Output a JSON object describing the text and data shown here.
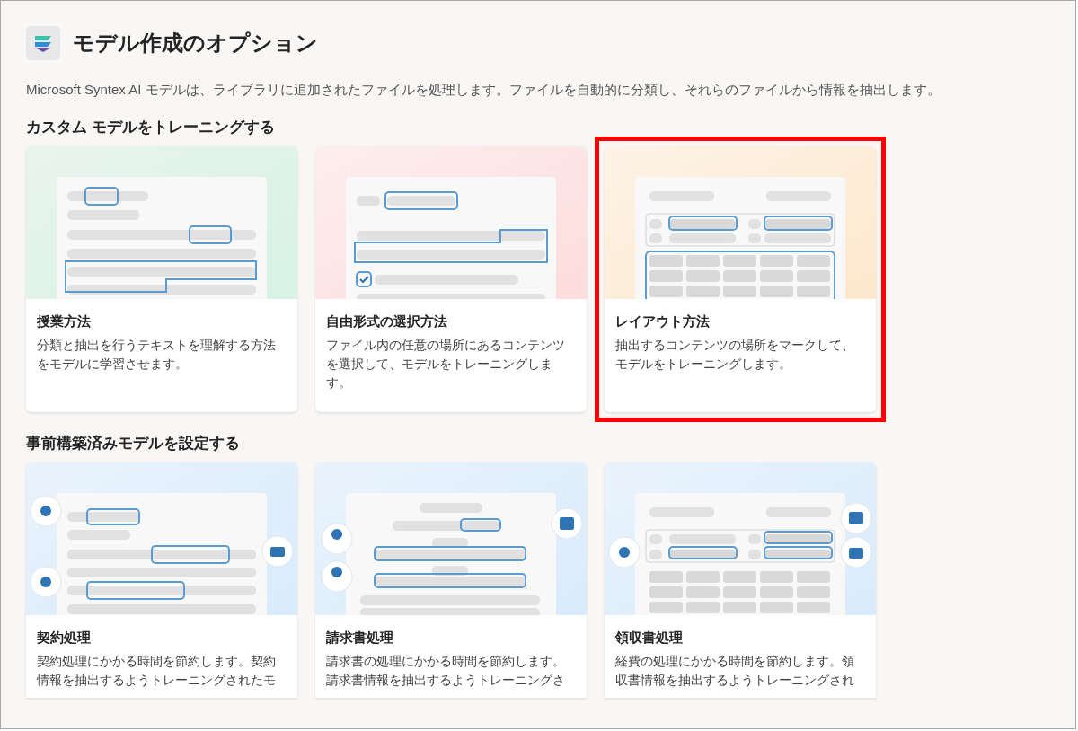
{
  "header": {
    "title": "モデル作成のオプション",
    "description": "Microsoft Syntex AI モデルは、ライブラリに追加されたファイルを処理します。ファイルを自動的に分類し、それらのファイルから情報を抽出します。"
  },
  "sections": [
    {
      "heading": "カスタム モデルをトレーニングする",
      "cards": [
        {
          "kind": "teaching",
          "title": "授業方法",
          "description": "分類と抽出を行うテキストを理解する方法をモデルに学習させます。",
          "highlighted": false
        },
        {
          "kind": "freeform",
          "title": "自由形式の選択方法",
          "description": "ファイル内の任意の場所にあるコンテンツを選択して、モデルをトレーニングします。",
          "highlighted": false
        },
        {
          "kind": "layout",
          "title": "レイアウト方法",
          "description": "抽出するコンテンツの場所をマークして、モデルをトレーニングします。",
          "highlighted": true
        }
      ]
    },
    {
      "heading": "事前構築済みモデルを設定する",
      "cards": [
        {
          "kind": "contract",
          "title": "契約処理",
          "description": "契約処理にかかる時間を節約します。契約情報を抽出するようトレーニングされたモ",
          "highlighted": false
        },
        {
          "kind": "invoice",
          "title": "請求書処理",
          "description": "請求書の処理にかかる時間を節約します。請求書情報を抽出するようトレーニングさ",
          "highlighted": false
        },
        {
          "kind": "receipt",
          "title": "領収書処理",
          "description": "経費の処理にかかる時間を節約します。領収書情報を抽出するようトレーニングされ",
          "highlighted": false
        }
      ]
    }
  ]
}
